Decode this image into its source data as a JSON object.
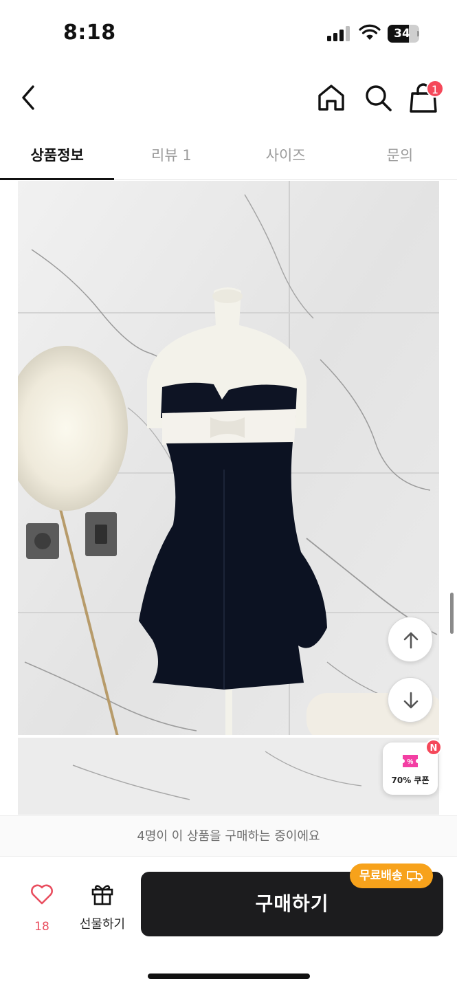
{
  "status_bar": {
    "time": "8:18",
    "battery": "34"
  },
  "nav": {
    "back_icon": "chevron-left-icon",
    "home_icon": "home-icon",
    "search_icon": "search-icon",
    "cart_icon": "shopping-bag-icon",
    "cart_count": "1"
  },
  "tabs": [
    {
      "label": "상품정보",
      "active": true
    },
    {
      "label": "리뷰 1",
      "active": false
    },
    {
      "label": "사이즈",
      "active": false
    },
    {
      "label": "문의",
      "active": false
    }
  ],
  "floating": {
    "scroll_up_icon": "arrow-up-icon",
    "scroll_down_icon": "arrow-down-icon",
    "coupon_label": "70% 쿠폰",
    "coupon_new_badge": "N"
  },
  "notice": {
    "text": "4명이 이 상품을 구매하는 중이에요"
  },
  "bottom": {
    "like_count": "18",
    "gift_label": "선물하기",
    "buy_label": "구매하기",
    "shipping_badge": "무료배송"
  },
  "colors": {
    "accent_red": "#f5485a",
    "buy_button": "#1c1c1e",
    "shipping_badge": "#f7a21b"
  }
}
